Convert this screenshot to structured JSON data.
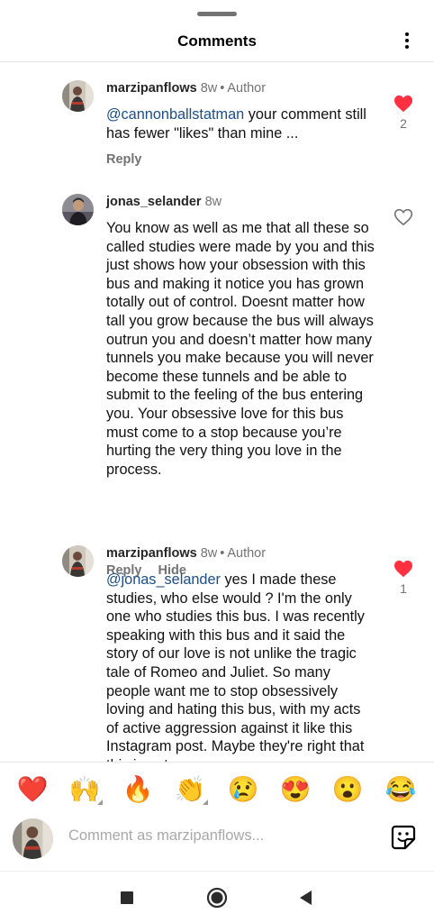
{
  "header": {
    "title": "Comments"
  },
  "comments": [
    {
      "username": "marzipanflows",
      "time": "8w",
      "author_label": "Author",
      "mention": "@cannonballstatman",
      "text": " your comment still has fewer \"likes\" than mine ...",
      "liked": true,
      "like_count": "2",
      "actions": [
        "Reply"
      ]
    },
    {
      "username": "jonas_selander",
      "time": "8w",
      "text": "You know as well as me that all these so called studies were made by you and this just shows how your obsession with this bus and making it notice you has grown totally out of control. Doesnt matter how tall you grow because the bus will always outrun you and doesn’t matter how many tunnels you make because you will never become these tunnels and be able to submit to the feeling of the bus entering you. Your obsessive love for this bus must come to a stop because you’re hurting the very thing you love in the process.",
      "liked": false,
      "actions": [
        "Reply",
        "Hide"
      ]
    },
    {
      "username": "marzipanflows",
      "time": "8w",
      "author_label": "Author",
      "mention": "@jonas_selander",
      "text": " yes I made these studies, who else would ? I'm the only one who studies this bus. I was recently speaking with this bus and it said the story of our love is not unlike the tragic tale of Romeo and Juliet. So many people want me to stop obsessively loving and hating this bus, with my acts of active aggression against it like this Instagram post. Maybe they're right that this is not",
      "liked": true,
      "like_count": "1"
    }
  ],
  "emoji_bar": [
    "❤️",
    "🙌",
    "🔥",
    "👏",
    "😢",
    "😍",
    "😮",
    "😂"
  ],
  "composer": {
    "placeholder": "Comment as marzipanflows..."
  },
  "colors": {
    "like_red": "#ff3040",
    "mention_blue": "#1c4e8a",
    "muted_gray": "#737373"
  },
  "icons": {
    "more": "vertical-dots-icon",
    "like_filled": "heart-filled-icon",
    "like_outline": "heart-outline-icon",
    "sticker": "sticker-icon",
    "nav": [
      "recents-square-icon",
      "home-circle-icon",
      "back-triangle-icon"
    ]
  }
}
